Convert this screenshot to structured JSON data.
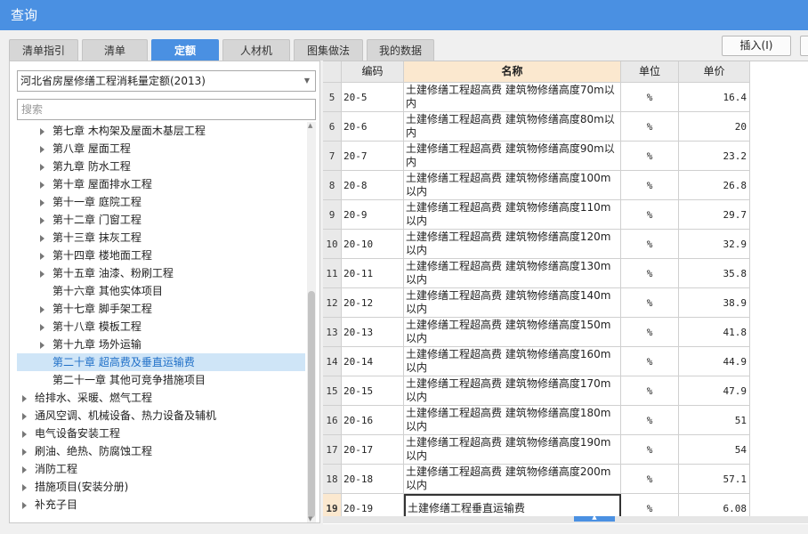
{
  "window": {
    "title": "查询"
  },
  "tabs": [
    {
      "label": "清单指引",
      "active": false
    },
    {
      "label": "清单",
      "active": false
    },
    {
      "label": "定额",
      "active": true
    },
    {
      "label": "人材机",
      "active": false
    },
    {
      "label": "图集做法",
      "active": false
    },
    {
      "label": "我的数据",
      "active": false
    }
  ],
  "toolbar": {
    "insert_label": "插入(I)"
  },
  "left": {
    "quota_select": {
      "value": "河北省房屋修缮工程消耗量定额(2013)"
    },
    "search": {
      "placeholder": "搜索"
    },
    "tree": [
      {
        "label": "第七章  木构架及屋面木基层工程",
        "level": 1,
        "expandable": true,
        "selected": false
      },
      {
        "label": "第八章  屋面工程",
        "level": 1,
        "expandable": true,
        "selected": false
      },
      {
        "label": "第九章  防水工程",
        "level": 1,
        "expandable": true,
        "selected": false
      },
      {
        "label": "第十章  屋面排水工程",
        "level": 1,
        "expandable": true,
        "selected": false
      },
      {
        "label": "第十一章  庭院工程",
        "level": 1,
        "expandable": true,
        "selected": false
      },
      {
        "label": "第十二章  门窗工程",
        "level": 1,
        "expandable": true,
        "selected": false
      },
      {
        "label": "第十三章  抹灰工程",
        "level": 1,
        "expandable": true,
        "selected": false
      },
      {
        "label": "第十四章  楼地面工程",
        "level": 1,
        "expandable": true,
        "selected": false
      },
      {
        "label": "第十五章  油漆、粉刷工程",
        "level": 1,
        "expandable": true,
        "selected": false
      },
      {
        "label": "第十六章  其他实体项目",
        "level": 1,
        "expandable": false,
        "selected": false
      },
      {
        "label": "第十七章  脚手架工程",
        "level": 1,
        "expandable": true,
        "selected": false
      },
      {
        "label": "第十八章  模板工程",
        "level": 1,
        "expandable": true,
        "selected": false
      },
      {
        "label": "第十九章  场外运输",
        "level": 1,
        "expandable": true,
        "selected": false
      },
      {
        "label": "第二十章  超高费及垂直运输费",
        "level": 1,
        "expandable": false,
        "selected": true
      },
      {
        "label": "第二十一章  其他可竞争措施项目",
        "level": 1,
        "expandable": false,
        "selected": false
      },
      {
        "label": "给排水、采暖、燃气工程",
        "level": 0,
        "expandable": true,
        "selected": false
      },
      {
        "label": "通风空调、机械设备、热力设备及辅机",
        "level": 0,
        "expandable": true,
        "selected": false
      },
      {
        "label": "电气设备安装工程",
        "level": 0,
        "expandable": true,
        "selected": false
      },
      {
        "label": "刷油、绝热、防腐蚀工程",
        "level": 0,
        "expandable": true,
        "selected": false
      },
      {
        "label": "消防工程",
        "level": 0,
        "expandable": true,
        "selected": false
      },
      {
        "label": "措施项目(安装分册)",
        "level": 0,
        "expandable": true,
        "selected": false
      },
      {
        "label": "补充子目",
        "level": 0,
        "expandable": true,
        "selected": false
      }
    ]
  },
  "table": {
    "columns": [
      "编码",
      "名称",
      "单位",
      "单价"
    ],
    "rows": [
      {
        "no": "5",
        "code": "20-5",
        "name": "土建修缮工程超高费 建筑物修缮高度70m以内",
        "unit": "%",
        "price": "16.4"
      },
      {
        "no": "6",
        "code": "20-6",
        "name": "土建修缮工程超高费 建筑物修缮高度80m以内",
        "unit": "%",
        "price": "20"
      },
      {
        "no": "7",
        "code": "20-7",
        "name": "土建修缮工程超高费 建筑物修缮高度90m以内",
        "unit": "%",
        "price": "23.2"
      },
      {
        "no": "8",
        "code": "20-8",
        "name": "土建修缮工程超高费 建筑物修缮高度100m以内",
        "unit": "%",
        "price": "26.8"
      },
      {
        "no": "9",
        "code": "20-9",
        "name": "土建修缮工程超高费 建筑物修缮高度110m以内",
        "unit": "%",
        "price": "29.7"
      },
      {
        "no": "10",
        "code": "20-10",
        "name": "土建修缮工程超高费 建筑物修缮高度120m以内",
        "unit": "%",
        "price": "32.9"
      },
      {
        "no": "11",
        "code": "20-11",
        "name": "土建修缮工程超高费 建筑物修缮高度130m以内",
        "unit": "%",
        "price": "35.8"
      },
      {
        "no": "12",
        "code": "20-12",
        "name": "土建修缮工程超高费 建筑物修缮高度140m以内",
        "unit": "%",
        "price": "38.9"
      },
      {
        "no": "13",
        "code": "20-13",
        "name": "土建修缮工程超高费 建筑物修缮高度150m以内",
        "unit": "%",
        "price": "41.8"
      },
      {
        "no": "14",
        "code": "20-14",
        "name": "土建修缮工程超高费 建筑物修缮高度160m以内",
        "unit": "%",
        "price": "44.9"
      },
      {
        "no": "15",
        "code": "20-15",
        "name": "土建修缮工程超高费 建筑物修缮高度170m以内",
        "unit": "%",
        "price": "47.9"
      },
      {
        "no": "16",
        "code": "20-16",
        "name": "土建修缮工程超高费 建筑物修缮高度180m以内",
        "unit": "%",
        "price": "51"
      },
      {
        "no": "17",
        "code": "20-17",
        "name": "土建修缮工程超高费 建筑物修缮高度190m以内",
        "unit": "%",
        "price": "54"
      },
      {
        "no": "18",
        "code": "20-18",
        "name": "土建修缮工程超高费 建筑物修缮高度200m以内",
        "unit": "%",
        "price": "57.1"
      },
      {
        "no": "19",
        "code": "20-19",
        "name": "土建修缮工程垂直运输费",
        "unit": "%",
        "price": "6.08",
        "current": true
      }
    ]
  },
  "colors": {
    "accent": "#4a90e2",
    "selected_bg": "#cfe5f7",
    "active_header": "#fbe8cf"
  }
}
